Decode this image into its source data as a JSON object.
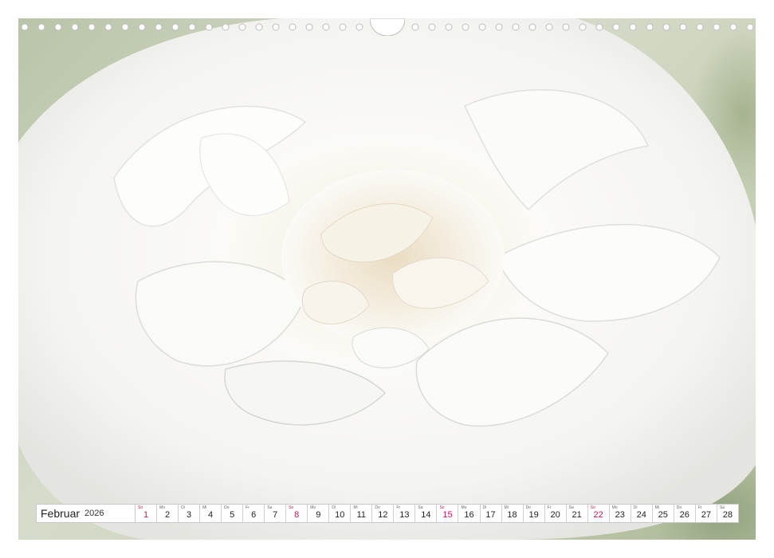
{
  "calendar": {
    "month": "Februar",
    "year": "2026",
    "sunday_color": "#c2185b",
    "days": [
      {
        "wd": "So",
        "num": "1",
        "sunday": true
      },
      {
        "wd": "Mo",
        "num": "2",
        "sunday": false
      },
      {
        "wd": "Di",
        "num": "3",
        "sunday": false
      },
      {
        "wd": "Mi",
        "num": "4",
        "sunday": false
      },
      {
        "wd": "Do",
        "num": "5",
        "sunday": false
      },
      {
        "wd": "Fr",
        "num": "6",
        "sunday": false
      },
      {
        "wd": "Sa",
        "num": "7",
        "sunday": false
      },
      {
        "wd": "So",
        "num": "8",
        "sunday": true
      },
      {
        "wd": "Mo",
        "num": "9",
        "sunday": false
      },
      {
        "wd": "Di",
        "num": "10",
        "sunday": false
      },
      {
        "wd": "Mi",
        "num": "11",
        "sunday": false
      },
      {
        "wd": "Do",
        "num": "12",
        "sunday": false
      },
      {
        "wd": "Fr",
        "num": "13",
        "sunday": false
      },
      {
        "wd": "Sa",
        "num": "14",
        "sunday": false
      },
      {
        "wd": "So",
        "num": "15",
        "sunday": true
      },
      {
        "wd": "Mo",
        "num": "16",
        "sunday": false
      },
      {
        "wd": "Di",
        "num": "17",
        "sunday": false
      },
      {
        "wd": "Mi",
        "num": "18",
        "sunday": false
      },
      {
        "wd": "Do",
        "num": "19",
        "sunday": false
      },
      {
        "wd": "Fr",
        "num": "20",
        "sunday": false
      },
      {
        "wd": "Sa",
        "num": "21",
        "sunday": false
      },
      {
        "wd": "So",
        "num": "22",
        "sunday": true
      },
      {
        "wd": "Mo",
        "num": "23",
        "sunday": false
      },
      {
        "wd": "Di",
        "num": "24",
        "sunday": false
      },
      {
        "wd": "Mi",
        "num": "25",
        "sunday": false
      },
      {
        "wd": "Do",
        "num": "26",
        "sunday": false
      },
      {
        "wd": "Fr",
        "num": "27",
        "sunday": false
      },
      {
        "wd": "Sa",
        "num": "28",
        "sunday": false
      }
    ]
  },
  "photo": {
    "subject": "white-rose-icon",
    "background_color": "#c9d1b8",
    "petal_color": "#f7f7f4",
    "center_color": "#efe6d2"
  }
}
